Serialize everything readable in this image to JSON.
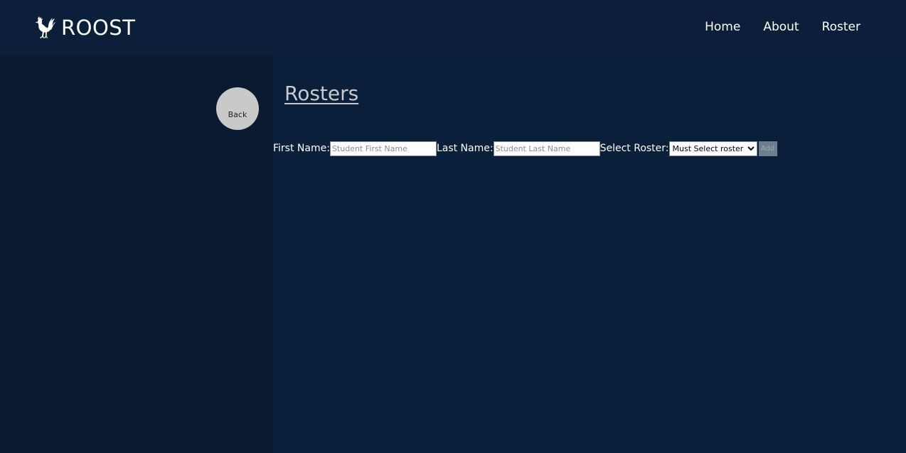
{
  "header": {
    "brand_name": "ROOST",
    "nav": [
      {
        "label": "Home"
      },
      {
        "label": "About"
      },
      {
        "label": "Roster"
      }
    ]
  },
  "sidebar": {
    "back_label": "Back"
  },
  "main": {
    "title": "Rosters",
    "form": {
      "first_name_label": "First Name:",
      "first_name_placeholder": "Student First Name",
      "first_name_value": "",
      "last_name_label": "Last Name:",
      "last_name_placeholder": "Student Last Name",
      "last_name_value": "",
      "select_roster_label": "Select Roster:",
      "select_roster_selected": "Must Select roster",
      "add_label": "Add"
    }
  },
  "colors": {
    "background": "#0a1f3a",
    "sidebar": "#091a31",
    "back_button": "#c9c9c9",
    "title": "#c7c9cc",
    "add_button_disabled": "#6d7e8f"
  },
  "icons": {
    "brand_icon": "rooster-icon"
  }
}
